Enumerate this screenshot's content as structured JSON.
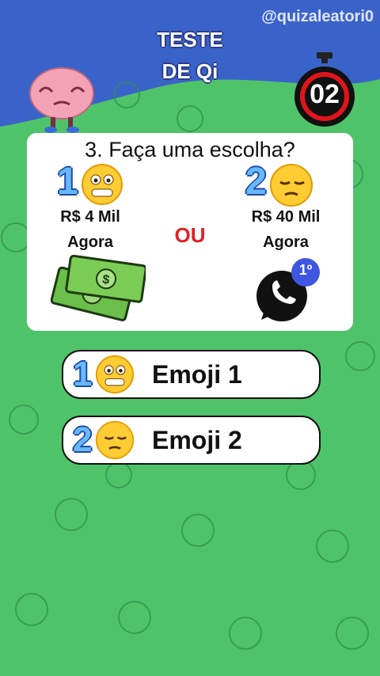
{
  "header": {
    "title_line1": "TESTE",
    "title_line2": "DE Qi",
    "handle": "@quizaleatori0",
    "timer": "02"
  },
  "question": {
    "text": "3. Faça uma escolha?",
    "separator": "OU",
    "option1": {
      "number": "1",
      "line1": "R$ 4 Mil",
      "line2": "Agora",
      "emoji": "grimacing-face-icon",
      "illustration": "money-bills-icon"
    },
    "option2": {
      "number": "2",
      "line1": "R$ 40 Mil",
      "line2": "Agora",
      "emoji": "relieved-face-icon",
      "illustration": "whatsapp-icon",
      "badge": "1º"
    }
  },
  "answers": [
    {
      "number": "1",
      "label": "Emoji 1",
      "emoji": "grimacing-face-icon"
    },
    {
      "number": "2",
      "label": "Emoji 2",
      "emoji": "relieved-face-icon"
    }
  ],
  "colors": {
    "background_blue": "#3a63c9",
    "background_green": "#4fc36a",
    "option_blue": "#67b9ff",
    "ou_red": "#e02126"
  }
}
